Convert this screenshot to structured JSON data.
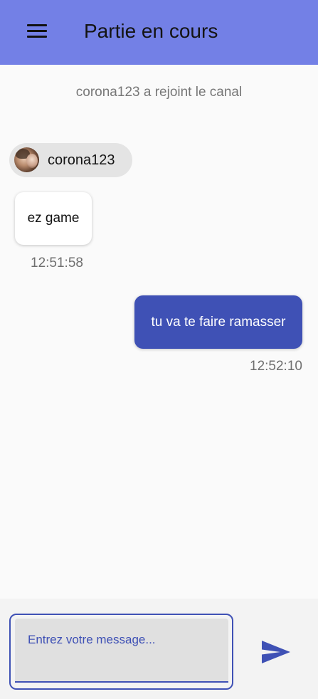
{
  "appbar": {
    "title": "Partie en cours",
    "menu_icon": "menu-icon",
    "color": "#7380e6"
  },
  "chat": {
    "system_message": "corona123 a rejoint le canal",
    "incoming": {
      "sender": "corona123",
      "avatar": "user-avatar",
      "text": "ez game",
      "time": "12:51:58"
    },
    "outgoing": {
      "text": "tu va te faire ramasser",
      "time": "12:52:10",
      "color": "#3f51b5"
    }
  },
  "composer": {
    "placeholder": "Entrez votre message...",
    "value": "",
    "send_icon": "send-icon"
  }
}
